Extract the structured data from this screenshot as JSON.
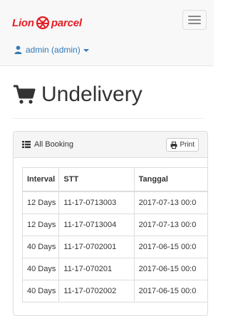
{
  "brand": {
    "name_left": "Lion",
    "name_right": "parcel",
    "color": "#e31e24"
  },
  "nav": {
    "user_label": "admin (admin)",
    "link_color": "#337ab7"
  },
  "page": {
    "title": "Undelivery"
  },
  "panel": {
    "title": "All Booking",
    "print_label": "Print"
  },
  "table": {
    "columns": [
      "Interval",
      "STT",
      "Tanggal"
    ],
    "rows": [
      [
        "12 Days",
        "11-17-0713003",
        "2017-07-13 00:0"
      ],
      [
        "12 Days",
        "11-17-0713004",
        "2017-07-13 00:0"
      ],
      [
        "40 Days",
        "11-17-0702001",
        "2017-06-15 00:0"
      ],
      [
        "40 Days",
        "11-17-070201",
        "2017-06-15 00:0"
      ],
      [
        "40 Days",
        "11-17-0702002",
        "2017-06-15 00:0"
      ]
    ]
  },
  "icons": [
    "hamburger-icon",
    "user-icon",
    "caret-down-icon",
    "cart-icon",
    "list-icon",
    "print-icon"
  ]
}
